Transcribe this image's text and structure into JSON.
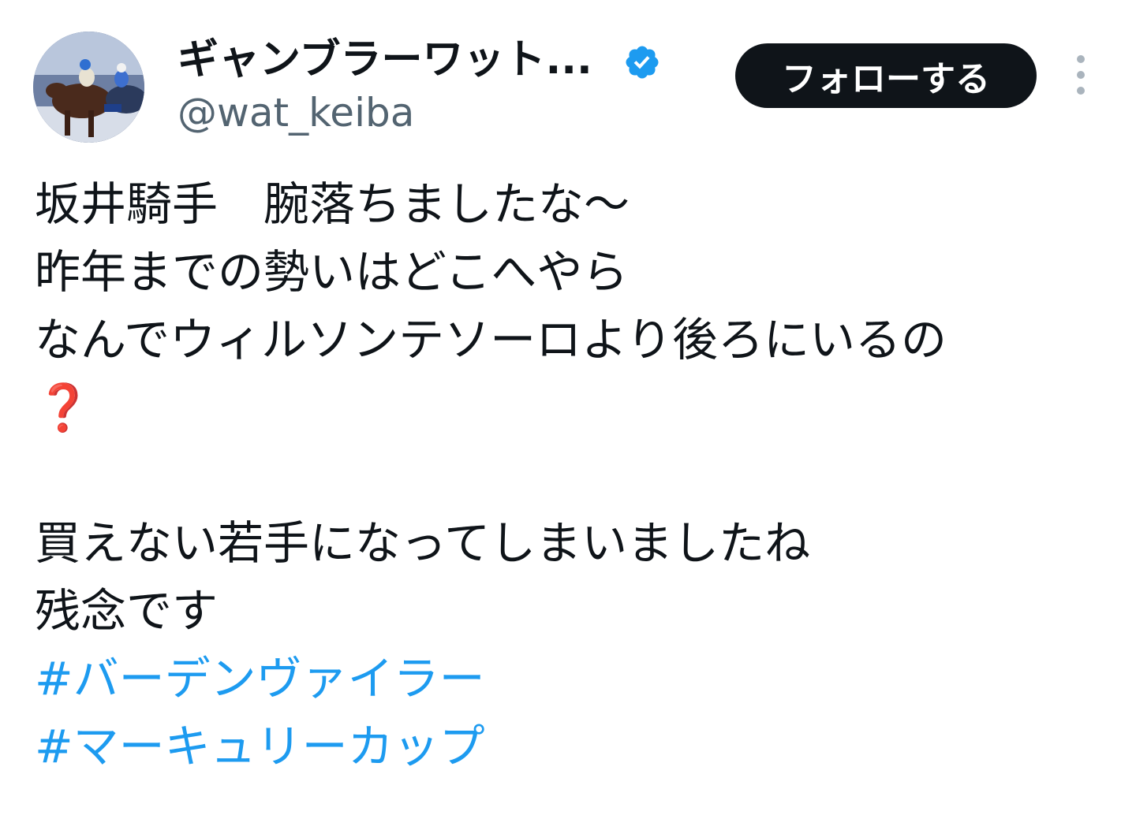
{
  "author": {
    "display_name": "ギャンブラーワット...",
    "handle": "@wat_keiba",
    "verified": true,
    "verified_icon": "verified-badge-icon",
    "verified_color": "#1d9bf0"
  },
  "actions": {
    "follow_label": "フォローする",
    "more_icon": "more-vertical-icon"
  },
  "tweet": {
    "lines": [
      "坂井騎手　腕落ちましたな〜",
      "昨年までの勢いはどこへやら",
      "なんでウィルソンテソーロより後ろにいるの",
      "❓"
    ],
    "lines2": [
      "買えない若手になってしまいましたね",
      "残念です"
    ],
    "hashtags": [
      "#バーデンヴァイラー",
      "#マーキュリーカップ"
    ]
  },
  "colors": {
    "text": "#0f1419",
    "secondary": "#536471",
    "link": "#1d9bf0",
    "follow_bg": "#0f1419"
  }
}
